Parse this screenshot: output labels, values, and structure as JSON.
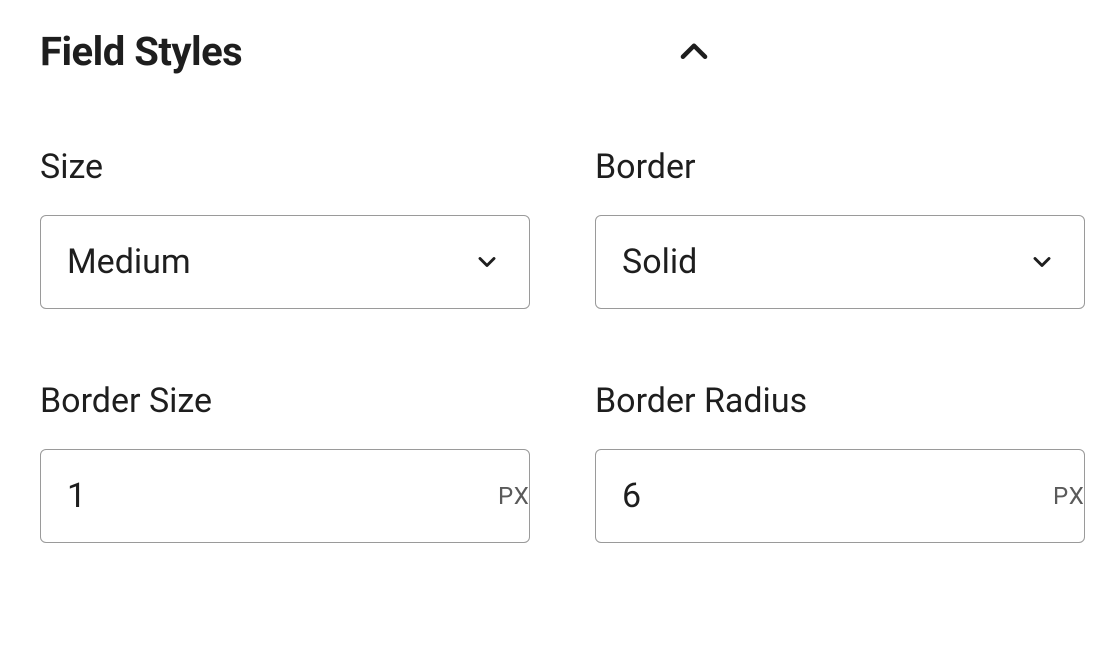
{
  "panel": {
    "title": "Field Styles"
  },
  "fields": {
    "size": {
      "label": "Size",
      "value": "Medium"
    },
    "border": {
      "label": "Border",
      "value": "Solid"
    },
    "border_size": {
      "label": "Border Size",
      "value": "1",
      "unit": "PX"
    },
    "border_radius": {
      "label": "Border Radius",
      "value": "6",
      "unit": "PX"
    }
  }
}
